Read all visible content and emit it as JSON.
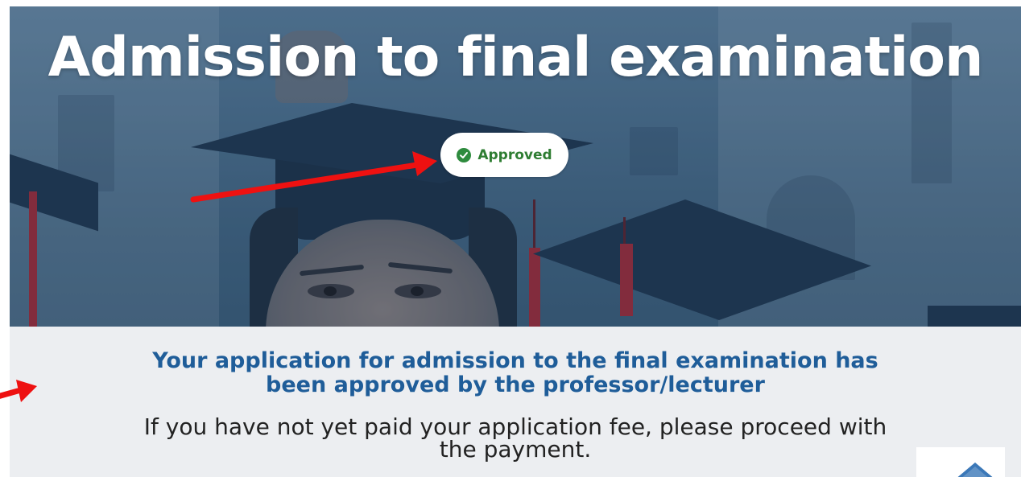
{
  "hero": {
    "title": "Admission to final examination",
    "status": {
      "label": "Approved",
      "icon": "check-circle-icon",
      "color": "#2e7d32"
    }
  },
  "message": {
    "title_line1": "Your application for admission to the final examination has",
    "title_line2": "been approved by the professor/lecturer",
    "body_line1": "If you have not yet paid your application fee, please proceed with",
    "body_line2": "the payment."
  },
  "colors": {
    "title_blue": "#1f5d99",
    "approved_green": "#2e7d32",
    "annotation_red": "#ee1111"
  },
  "scroll_top": {
    "icon": "chevron-up-icon"
  }
}
